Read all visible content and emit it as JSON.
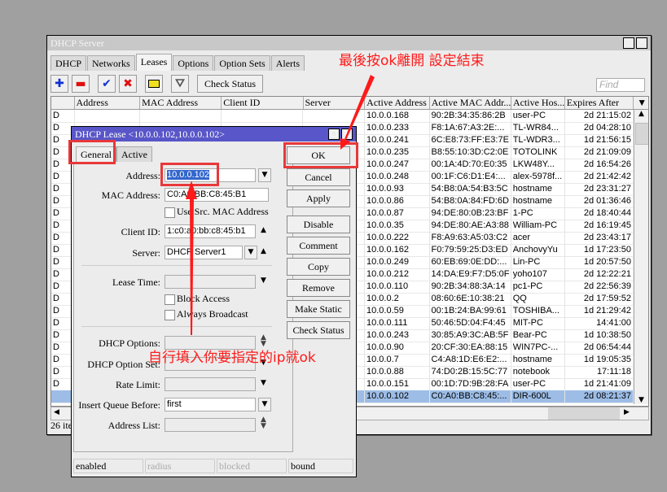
{
  "main_window": {
    "title": "DHCP Server",
    "tabs": [
      "DHCP",
      "Networks",
      "Leases",
      "Options",
      "Option Sets",
      "Alerts"
    ],
    "active_tab": "Leases",
    "toolbar": {
      "check_status": "Check Status",
      "find_placeholder": "Find"
    },
    "columns": [
      "",
      "Address",
      "MAC Address",
      "Client ID",
      "Server",
      "Active Address",
      "Active MAC Addr...",
      "Active Hos...",
      "Expires After"
    ],
    "rows": [
      {
        "flag": "D",
        "active_address": "10.0.0.168",
        "active_mac": "90:2B:34:35:86:2B",
        "host": "user-PC",
        "expires": "2d 21:15:02"
      },
      {
        "flag": "D",
        "active_address": "10.0.0.233",
        "active_mac": "F8:1A:67:A3:2E:...",
        "host": "TL-WR84...",
        "expires": "2d 04:28:10"
      },
      {
        "flag": "D",
        "active_address": "10.0.0.241",
        "active_mac": "6C:E8:73:FF:E3:7E",
        "host": "TL-WDR3...",
        "expires": "1d 21:56:15"
      },
      {
        "flag": "D",
        "active_address": "10.0.0.235",
        "active_mac": "B8:55:10:3D:C2:0E",
        "host": "TOTOLINK",
        "expires": "2d 21:09:09"
      },
      {
        "flag": "D",
        "active_address": "10.0.0.247",
        "active_mac": "00:1A:4D:70:E0:35",
        "host": "LKW48Y...",
        "expires": "2d 16:54:26"
      },
      {
        "flag": "D",
        "active_address": "10.0.0.248",
        "active_mac": "00:1F:C6:D1:E4:...",
        "host": "alex-5978f...",
        "expires": "2d 21:42:42"
      },
      {
        "flag": "D",
        "active_address": "10.0.0.93",
        "active_mac": "54:B8:0A:54:B3:5C",
        "host": "hostname",
        "expires": "2d 23:31:27"
      },
      {
        "flag": "D",
        "active_address": "10.0.0.86",
        "active_mac": "54:B8:0A:84:FD:6D",
        "host": "hostname",
        "expires": "2d 01:36:46"
      },
      {
        "flag": "D",
        "active_address": "10.0.0.87",
        "active_mac": "94:DE:80:0B:23:BF",
        "host": "1-PC",
        "expires": "2d 18:40:44"
      },
      {
        "flag": "D",
        "active_address": "10.0.0.35",
        "active_mac": "94:DE:80:AE:A3:88",
        "host": "William-PC",
        "expires": "2d 16:19:45"
      },
      {
        "flag": "D",
        "active_address": "10.0.0.222",
        "active_mac": "F8:A9:63:A5:03:C2",
        "host": "acer",
        "expires": "2d 23:43:17"
      },
      {
        "flag": "D",
        "active_address": "10.0.0.162",
        "active_mac": "F0:79:59:25:D3:ED",
        "host": "AnchovyYu",
        "expires": "1d 17:23:50"
      },
      {
        "flag": "D",
        "active_address": "10.0.0.249",
        "active_mac": "60:EB:69:0E:DD:...",
        "host": "Lin-PC",
        "expires": "1d 20:57:50"
      },
      {
        "flag": "D",
        "active_address": "10.0.0.212",
        "active_mac": "14:DA:E9:F7:D5:0F",
        "host": "yoho107",
        "expires": "2d 12:22:21"
      },
      {
        "flag": "D",
        "active_address": "10.0.0.110",
        "active_mac": "90:2B:34:88:3A:14",
        "host": "pc1-PC",
        "expires": "2d 22:56:39"
      },
      {
        "flag": "D",
        "active_address": "10.0.0.2",
        "active_mac": "08:60:6E:10:38:21",
        "host": "QQ",
        "expires": "2d 17:59:52"
      },
      {
        "flag": "D",
        "active_address": "10.0.0.59",
        "active_mac": "00:1B:24:BA:99:61",
        "host": "TOSHIBA...",
        "expires": "1d 21:29:42"
      },
      {
        "flag": "D",
        "active_address": "10.0.0.111",
        "active_mac": "50:46:5D:04:F4:45",
        "host": "MIT-PC",
        "expires": "14:41:00"
      },
      {
        "flag": "D",
        "active_address": "10.0.0.243",
        "active_mac": "30:85:A9:3C:AB:5F",
        "host": "Bear-PC",
        "expires": "1d 10:38:50"
      },
      {
        "flag": "D",
        "active_address": "10.0.0.90",
        "active_mac": "20:CF:30:EA:88:15",
        "host": "WIN7PC-...",
        "expires": "2d 06:54:44"
      },
      {
        "flag": "D",
        "active_address": "10.0.0.7",
        "active_mac": "C4:A8:1D:E6:E2:...",
        "host": "hostname",
        "expires": "1d 19:05:35"
      },
      {
        "flag": "D",
        "active_address": "10.0.0.88",
        "active_mac": "74:D0:2B:15:5C:77",
        "host": "notebook",
        "expires": "17:11:18"
      },
      {
        "flag": "D",
        "active_address": "10.0.0.151",
        "active_mac": "00:1D:7D:9B:28:FA",
        "host": "user-PC",
        "expires": "1d 21:41:09"
      },
      {
        "flag": "",
        "active_address": "10.0.0.102",
        "active_mac": "C0:A0:BB:C8:45:...",
        "host": "DIR-600L",
        "expires": "2d 08:21:37",
        "selected": true
      }
    ],
    "status": "26 items"
  },
  "dialog": {
    "title": "DHCP Lease <10.0.0.102,10.0.0.102>",
    "tabs": [
      "General",
      "Active"
    ],
    "fields": {
      "address": {
        "label": "Address:",
        "value": "10.0.0.102"
      },
      "mac": {
        "label": "MAC Address:",
        "value": "C0:A0:BB:C8:45:B1"
      },
      "use_src_mac": "Use Src. MAC Address",
      "client_id": {
        "label": "Client ID:",
        "value": "1:c0:a0:bb:c8:45:b1"
      },
      "server": {
        "label": "Server:",
        "value": "DHCP Server1"
      },
      "lease_time": {
        "label": "Lease Time:",
        "value": ""
      },
      "block_access": "Block Access",
      "always_broadcast": "Always Broadcast",
      "dhcp_options": {
        "label": "DHCP Options:",
        "value": ""
      },
      "dhcp_option_set": {
        "label": "DHCP Option Set:",
        "value": ""
      },
      "rate_limit": {
        "label": "Rate Limit:",
        "value": ""
      },
      "insert_queue_before": {
        "label": "Insert Queue Before:",
        "value": "first"
      },
      "address_list": {
        "label": "Address List:",
        "value": ""
      }
    },
    "buttons": [
      "OK",
      "Cancel",
      "Apply",
      "Disable",
      "Comment",
      "Copy",
      "Remove",
      "Make Static",
      "Check Status"
    ],
    "status": [
      "enabled",
      "radius",
      "blocked",
      "bound"
    ]
  },
  "annotations": {
    "top": "最後按ok離開 設定結束",
    "middle": "自行填入你要指定的ip就ok",
    "color": "#ff1a1a"
  }
}
